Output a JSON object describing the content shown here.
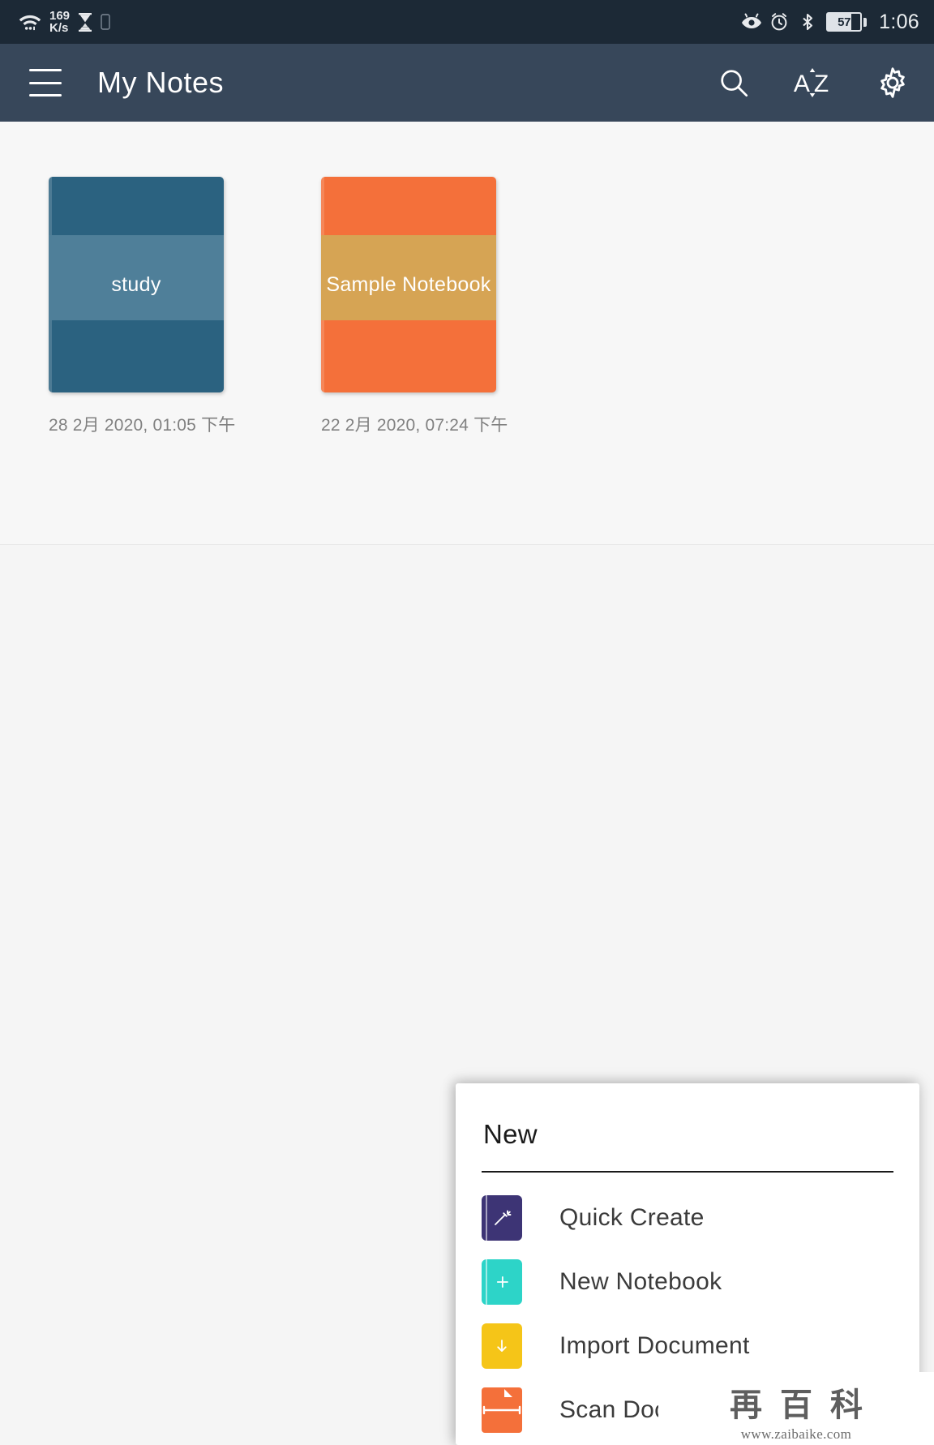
{
  "status_bar": {
    "wifi_icon": "wifi-icon",
    "net_speed_value": "169",
    "net_speed_unit": "K/s",
    "hourglass_icon": "hourglass-icon",
    "sim_icon": "sim-card-icon",
    "eye_icon": "eye-icon",
    "alarm_icon": "alarm-clock-icon",
    "bluetooth_icon": "bluetooth-icon",
    "battery_level": "57",
    "time": "1:06",
    "background_color": "#1c2936"
  },
  "app_bar": {
    "menu_icon": "hamburger-menu-icon",
    "title": "My Notes",
    "search_icon": "search-icon",
    "sort_label": "AZ",
    "sort_icon": "sort-alphabetical-icon",
    "settings_icon": "gear-icon",
    "background_color": "#37475a"
  },
  "notebooks": [
    {
      "title": "study",
      "date": "28 2月 2020, 01:05 下午",
      "cover_color": "#2b6280",
      "band_color": "#4f7f99"
    },
    {
      "title": "Sample Notebook",
      "date": "22 2月 2020, 07:24 下午",
      "cover_color": "#f4703a",
      "band_color": "#d6a454"
    }
  ],
  "popup": {
    "title": "New",
    "items": [
      {
        "label": "Quick Create",
        "icon": "magic-wand-book-icon",
        "icon_color": "#3d3475",
        "glyph": "wand"
      },
      {
        "label": "New Notebook",
        "icon": "plus-book-icon",
        "icon_color": "#2dd4c8",
        "glyph": "plus"
      },
      {
        "label": "Import Document",
        "icon": "download-document-icon",
        "icon_color": "#f5c518",
        "glyph": "arrow-down"
      },
      {
        "label": "Scan Docu",
        "icon": "scan-document-icon",
        "icon_color": "#f4703a",
        "glyph": "scan"
      }
    ]
  },
  "watermark": {
    "glyph_1": "再",
    "glyph_2": "百",
    "glyph_3": "科",
    "url": "www.zaibaike.com"
  }
}
